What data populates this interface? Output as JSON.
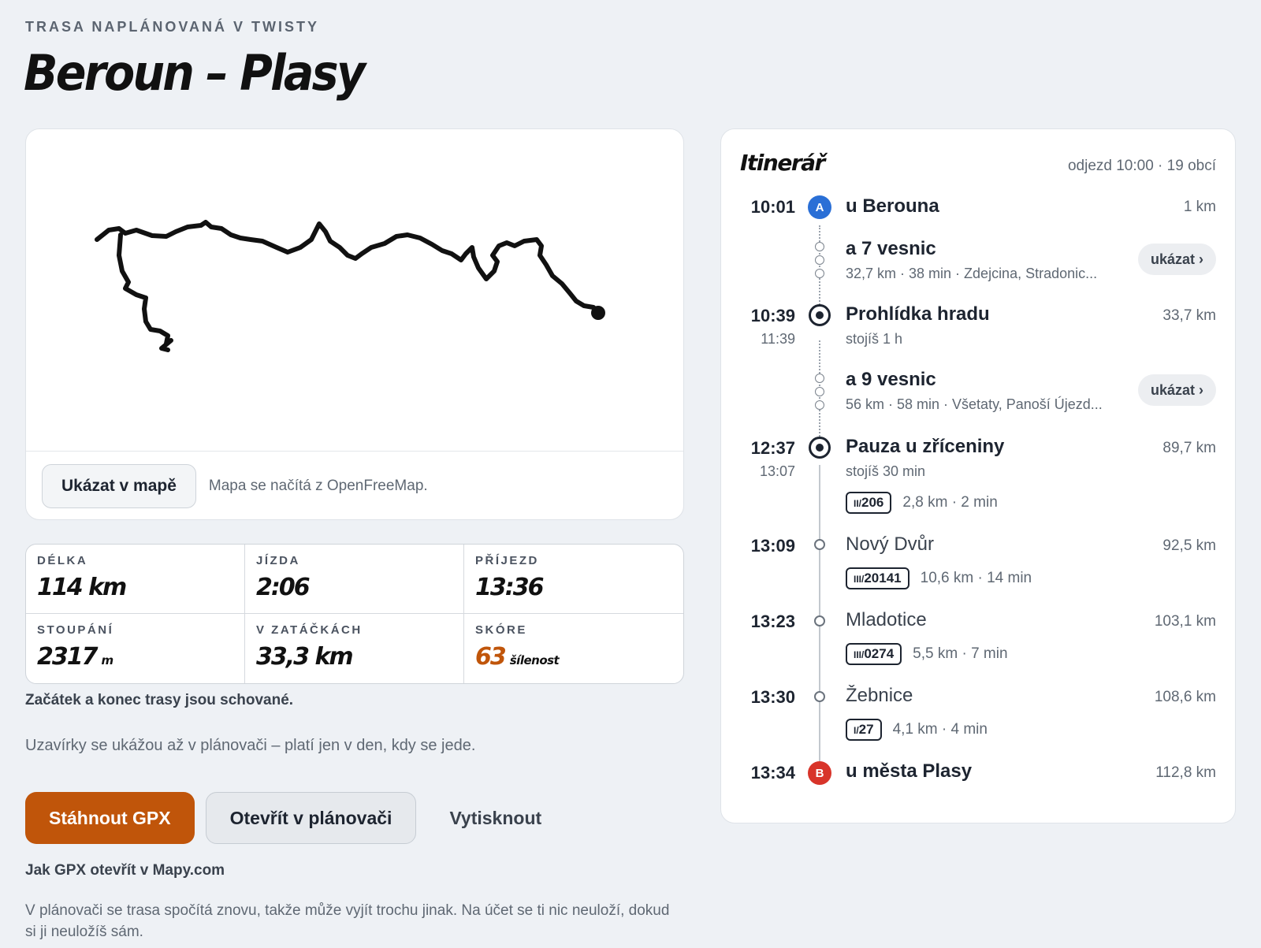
{
  "header": {
    "eyebrow": "TRASA NAPLÁNOVANÁ V TWISTY",
    "title": "Beroun – Plasy"
  },
  "map": {
    "show_button": "Ukázat v mapě",
    "note": "Mapa se načítá z OpenFreeMap."
  },
  "stats": {
    "length_label": "DÉLKA",
    "length_value": "114 km",
    "ride_label": "JÍZDA",
    "ride_value": "2:06",
    "arrival_label": "PŘÍJEZD",
    "arrival_value": "13:36",
    "climb_label": "STOUPÁNÍ",
    "climb_value": "2317",
    "climb_unit": "m",
    "curves_label": "V ZATÁČKÁCH",
    "curves_value": "33,3 km",
    "score_label": "SKÓRE",
    "score_value": "63",
    "score_unit": "šílenost"
  },
  "notes": {
    "hidden": "Začátek a konec trasy jsou schované.",
    "closures": "Uzavírky se ukážou až v plánovači – platí jen v den, kdy se jede.",
    "gpx_help": "Jak GPX otevřít v Mapy.com",
    "planner": "V plánovači se trasa spočítá znovu, takže může vyjít trochu jinak. Na účet se ti nic neuloží, dokud si ji neuložíš sám."
  },
  "actions": {
    "download": "Stáhnout GPX",
    "open_planner": "Otevřít v plánovači",
    "print": "Vytisknout"
  },
  "itinerary": {
    "title": "Itinerář",
    "meta": "odjezd 10:00 · 19 obcí",
    "start": {
      "time": "10:01",
      "marker": "A",
      "place": "u Berouna",
      "dist": "1 km"
    },
    "villages1": {
      "place": "a 7 vesnic",
      "sub": "32,7 km · 38 min · Zdejcina, Stradonic...",
      "button": "ukázat ›"
    },
    "stop1": {
      "time": "10:39",
      "time2": "11:39",
      "place": "Prohlídka hradu",
      "sub": "stojíš 1 h",
      "dist": "33,7 km"
    },
    "villages2": {
      "place": "a 9 vesnic",
      "sub": "56 km · 58 min · Všetaty, Panoší Újezd...",
      "button": "ukázat ›"
    },
    "stop2": {
      "time": "12:37",
      "time2": "13:07",
      "place": "Pauza u zříceniny",
      "sub": "stojíš 30 min",
      "dist": "89,7 km",
      "road_class": "II/",
      "road_num": "206",
      "road_info": "2,8 km · 2 min"
    },
    "wp1": {
      "time": "13:09",
      "place": "Nový Dvůr",
      "dist": "92,5 km",
      "road_class": "III/",
      "road_num": "20141",
      "road_info": "10,6 km · 14 min"
    },
    "wp2": {
      "time": "13:23",
      "place": "Mladotice",
      "dist": "103,1 km",
      "road_class": "III/",
      "road_num": "0274",
      "road_info": "5,5 km · 7 min"
    },
    "wp3": {
      "time": "13:30",
      "place": "Žebnice",
      "dist": "108,6 km",
      "road_class": "I/",
      "road_num": "27",
      "road_info": "4,1 km · 4 min"
    },
    "end": {
      "time": "13:34",
      "marker": "B",
      "place": "u města Plasy",
      "dist": "112,8 km"
    }
  },
  "colors": {
    "accent": "#c0550a",
    "marker_a": "#2a6fd6",
    "marker_b": "#d8342a"
  }
}
